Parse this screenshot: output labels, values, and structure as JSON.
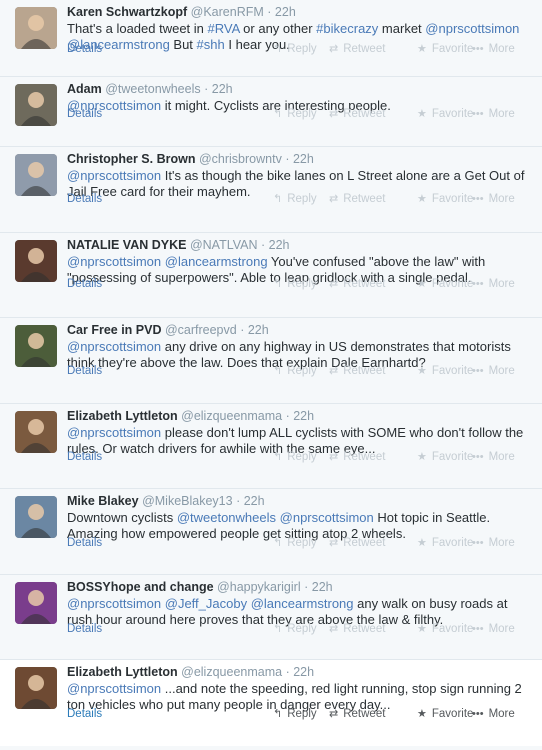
{
  "actions": {
    "details": "Details",
    "reply": "Reply",
    "retweet": "Retweet",
    "favorite": "Favorite",
    "more": "More"
  },
  "tweets": [
    {
      "name": "Karen Schwartzkopf",
      "handle": "@KarenRFM",
      "sep": "·",
      "time": "22h",
      "segments": [
        {
          "t": "That's a loaded tweet in "
        },
        {
          "t": "#RVA",
          "m": true
        },
        {
          "t": " or any other "
        },
        {
          "t": "#bikecrazy",
          "m": true
        },
        {
          "t": " market "
        },
        {
          "t": "@nprscottsimon",
          "m": true
        },
        {
          "t": " "
        },
        {
          "t": "@lancearmstrong",
          "m": true
        },
        {
          "t": " But "
        },
        {
          "t": "#shh",
          "m": true
        },
        {
          "t": " I hear you."
        }
      ]
    },
    {
      "name": "Adam",
      "handle": "@tweetonwheels",
      "sep": "·",
      "time": "22h",
      "segments": [
        {
          "t": "@nprscottsimon",
          "m": true
        },
        {
          "t": " it might. Cyclists are interesting people."
        }
      ]
    },
    {
      "name": "Christopher S. Brown",
      "handle": "@chrisbrowntv",
      "sep": "·",
      "time": "22h",
      "segments": [
        {
          "t": "@nprscottsimon",
          "m": true
        },
        {
          "t": " It's as though the bike lanes on L Street alone are a Get Out of Jail Free card for their mayhem."
        }
      ]
    },
    {
      "name": "NATALIE VAN DYKE",
      "handle": "@NATLVAN",
      "sep": "·",
      "time": "22h",
      "segments": [
        {
          "t": "@nprscottsimon",
          "m": true
        },
        {
          "t": " "
        },
        {
          "t": "@lancearmstrong",
          "m": true
        },
        {
          "t": " You've confused \"above the law\" with \"possessing of superpowers\".  Able to leap gridlock with a single pedal."
        }
      ]
    },
    {
      "name": "Car Free in PVD",
      "handle": "@carfreepvd",
      "sep": "·",
      "time": "22h",
      "segments": [
        {
          "t": "@nprscottsimon",
          "m": true
        },
        {
          "t": " any drive on any highway in US demonstrates that motorists think they're above the law. Does that explain Dale Earnhartd?"
        }
      ]
    },
    {
      "name": "Elizabeth Lyttleton",
      "handle": "@elizqueenmama",
      "sep": "·",
      "time": "22h",
      "segments": [
        {
          "t": "@nprscottsimon",
          "m": true
        },
        {
          "t": " please don't lump ALL cyclists with SOME who don't follow the rules. Or watch drivers for awhile with the same eye..."
        }
      ]
    },
    {
      "name": "Mike Blakey",
      "handle": "@MikeBlakey13",
      "sep": "·",
      "time": "22h",
      "segments": [
        {
          "t": "Downtown cyclists "
        },
        {
          "t": "@tweetonwheels",
          "m": true
        },
        {
          "t": " "
        },
        {
          "t": "@nprscottsimon",
          "m": true
        },
        {
          "t": " Hot topic in Seattle. Amazing how empowered people get sitting atop 2 wheels."
        }
      ]
    },
    {
      "name": "BOSSYhope and change",
      "handle": "@happykarigirl",
      "sep": "·",
      "time": "22h",
      "segments": [
        {
          "t": "@nprscottsimon",
          "m": true
        },
        {
          "t": " "
        },
        {
          "t": "@Jeff_Jacoby",
          "m": true
        },
        {
          "t": " "
        },
        {
          "t": "@lancearmstrong",
          "m": true
        },
        {
          "t": " any walk on busy roads at rush hour around here proves that they are above the law & filthy."
        }
      ]
    },
    {
      "name": "Elizabeth Lyttleton",
      "handle": "@elizqueenmama",
      "sep": "·",
      "time": "22h",
      "segments": [
        {
          "t": "@nprscottsimon",
          "m": true
        },
        {
          "t": " ...and note the speeding, red light running, stop sign running 2 ton vehicles who put many people in danger every day..."
        }
      ]
    }
  ],
  "avatar_colors": [
    "#b9a58f",
    "#6e6a5c",
    "#8f9bab",
    "#5a3a2e",
    "#4c5d3a",
    "#7b5a3f",
    "#6b87a3",
    "#7a3d8c",
    "#6e4a33"
  ]
}
